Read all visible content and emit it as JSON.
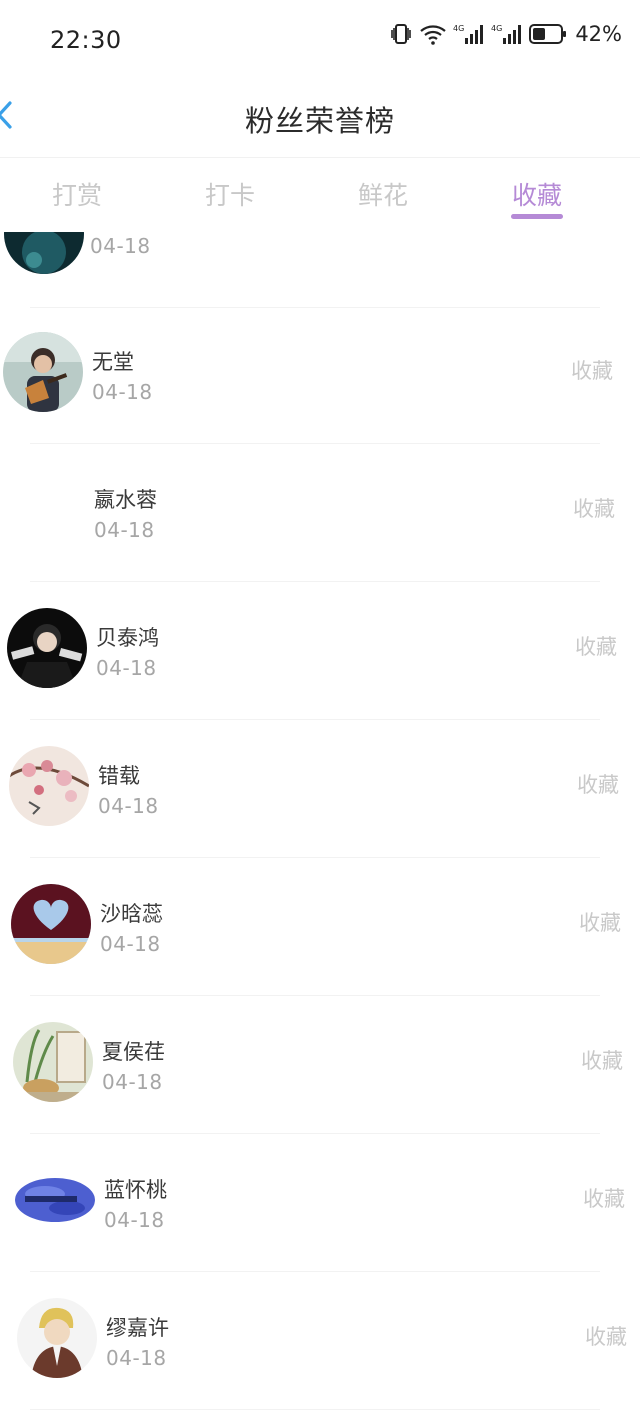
{
  "status_bar": {
    "time": "22:30",
    "battery": "42%",
    "icons": [
      "vibrate-icon",
      "wifi-icon",
      "signal-4g-icon",
      "signal-4g-icon",
      "battery-icon"
    ]
  },
  "header": {
    "title": "粉丝荣誉榜",
    "back_icon": "chevron-left-icon"
  },
  "tabs": [
    {
      "label": "打赏",
      "active": false
    },
    {
      "label": "打卡",
      "active": false
    },
    {
      "label": "鲜花",
      "active": false
    },
    {
      "label": "收藏",
      "active": true
    }
  ],
  "colors": {
    "accent": "#b58ad6",
    "inactive_tab": "#c8c8c8",
    "date_text": "#a6a6a6",
    "action_text": "#c9c9c9"
  },
  "list": {
    "partial_top_date": "04-18",
    "items": [
      {
        "name": "无堂",
        "date": "04-18",
        "action": "收藏",
        "avatar": "guitar-portrait"
      },
      {
        "name": "嬴水蓉",
        "date": "04-18",
        "action": "收藏",
        "avatar": "blank"
      },
      {
        "name": "贝泰鸿",
        "date": "04-18",
        "action": "收藏",
        "avatar": "dark-portrait"
      },
      {
        "name": "错载",
        "date": "04-18",
        "action": "收藏",
        "avatar": "blossom-painting"
      },
      {
        "name": "沙晗蕊",
        "date": "04-18",
        "action": "收藏",
        "avatar": "heart-card"
      },
      {
        "name": "夏侯荏",
        "date": "04-18",
        "action": "收藏",
        "avatar": "plant-still-life"
      },
      {
        "name": "蓝怀桃",
        "date": "04-18",
        "action": "收藏",
        "avatar": "blue-brush"
      },
      {
        "name": "缪嘉许",
        "date": "04-18",
        "action": "收藏",
        "avatar": "anime-blond"
      }
    ]
  }
}
